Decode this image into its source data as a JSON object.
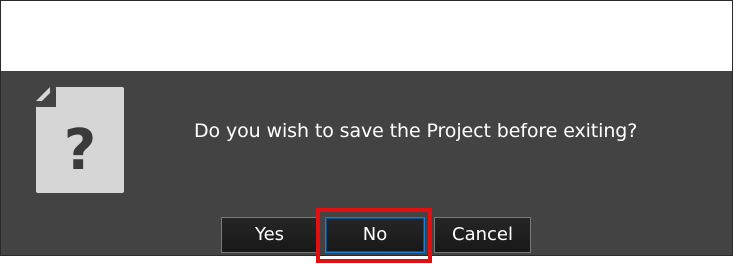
{
  "dialog": {
    "message": "Do you wish to save the Project before exiting?",
    "icon": "document-question-icon",
    "background_color": "#434343"
  },
  "buttons": {
    "yes_label": "Yes",
    "no_label": "No",
    "cancel_label": "Cancel"
  },
  "highlight": {
    "target": "no-button",
    "color": "#e10f0f"
  }
}
